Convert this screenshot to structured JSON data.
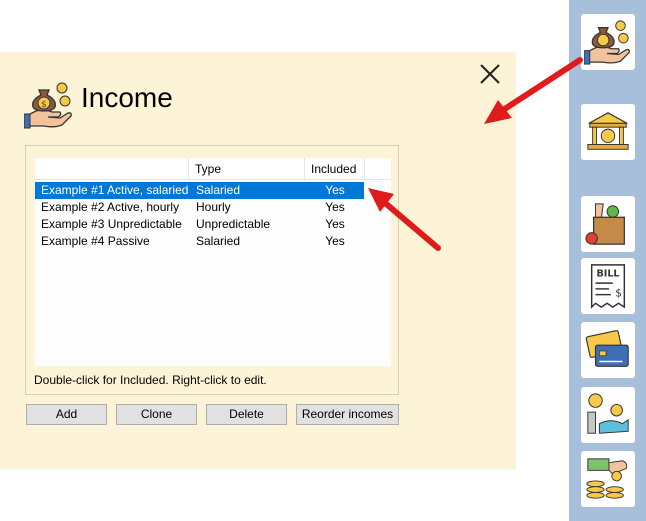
{
  "dialog": {
    "title": "Income",
    "hint": "Double-click for Included. Right-click to edit.",
    "close_glyph": "×"
  },
  "list": {
    "columns": [
      "",
      "Type",
      "Included"
    ],
    "rows": [
      {
        "name": "Example #1 Active, salaried",
        "type": "Salaried",
        "included": "Yes",
        "selected": true
      },
      {
        "name": "Example #2 Active, hourly",
        "type": "Hourly",
        "included": "Yes",
        "selected": false
      },
      {
        "name": "Example #3 Unpredictable",
        "type": "Unpredictable",
        "included": "Yes",
        "selected": false
      },
      {
        "name": "Example #4 Passive",
        "type": "Salaried",
        "included": "Yes",
        "selected": false
      }
    ]
  },
  "buttons": {
    "add": "Add",
    "clone": "Clone",
    "delete": "Delete",
    "reorder": "Reorder incomes"
  },
  "sidebar": {
    "items": [
      {
        "icon": "money-bag-hand-icon"
      },
      {
        "icon": "bank-icon"
      },
      {
        "icon": "grocery-bag-icon"
      },
      {
        "icon": "bill-icon"
      },
      {
        "icon": "credit-cards-icon"
      },
      {
        "icon": "savings-transfer-icon"
      },
      {
        "icon": "cash-coins-icon"
      }
    ]
  },
  "colors": {
    "panel": "#fdf3d6",
    "sidebar": "#a8bfdc",
    "selection": "#0078d7",
    "annotation_arrow": "#e01b1b"
  }
}
